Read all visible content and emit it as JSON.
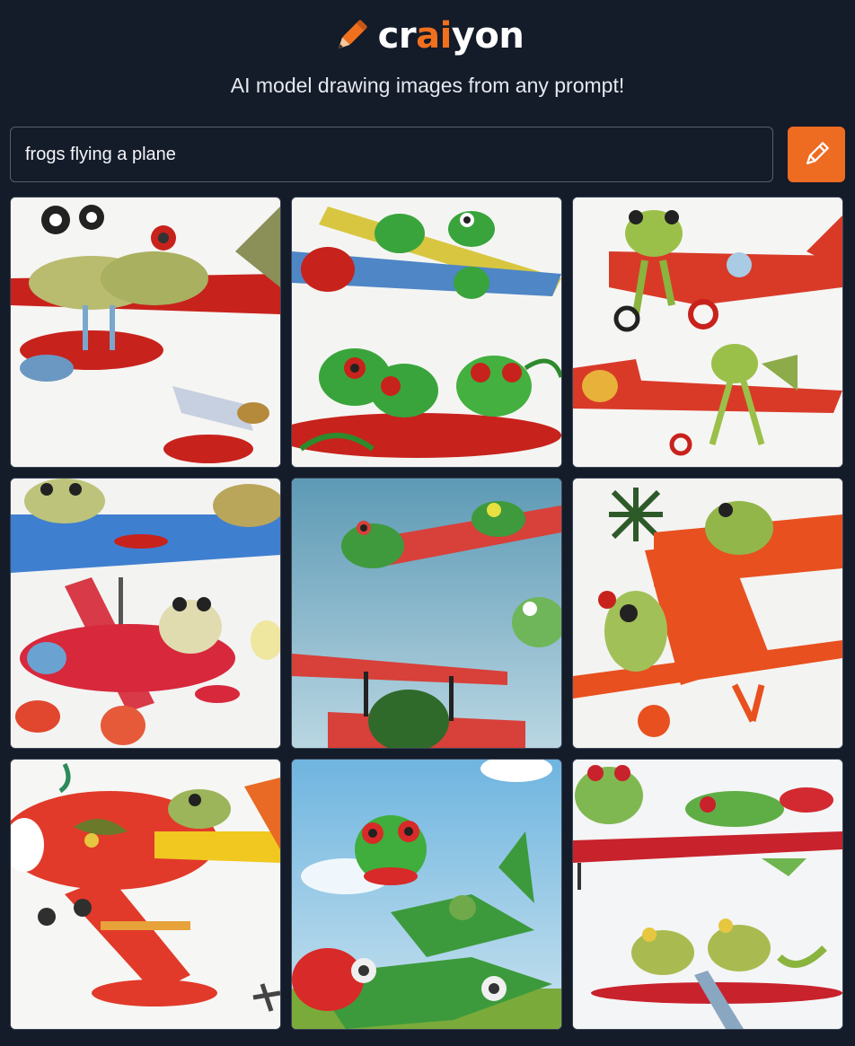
{
  "brand": {
    "logo_prefix": "cr",
    "logo_accent": "ai",
    "logo_suffix": "yon",
    "tagline": "AI model drawing images from any prompt!",
    "accent_color": "#f0701e"
  },
  "search": {
    "value": "frogs flying a plane",
    "draw_icon": "pencil-icon"
  },
  "results": {
    "count": 9,
    "tiles": [
      {
        "subject": "frog-biplane-red"
      },
      {
        "subject": "frogs-yellow-plane"
      },
      {
        "subject": "frog-red-planes"
      },
      {
        "subject": "frogs-blue-red-biplane"
      },
      {
        "subject": "frogs-sky-blue"
      },
      {
        "subject": "frog-orange-plane"
      },
      {
        "subject": "frog-red-plane-yellow"
      },
      {
        "subject": "frog-green-plane"
      },
      {
        "subject": "frogs-red-planes-pair"
      }
    ]
  }
}
